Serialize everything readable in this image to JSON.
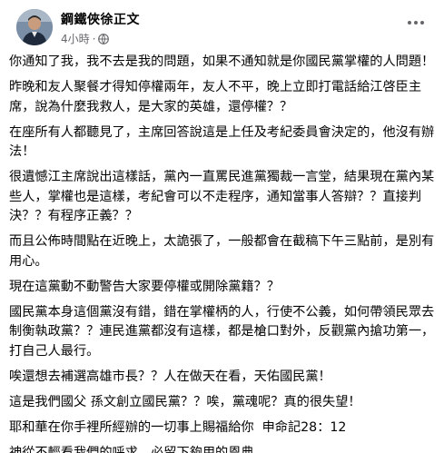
{
  "post": {
    "author": "鋼鐵俠徐正文",
    "time": "4小時",
    "separator": "·",
    "paragraphs": [
      "你通知了我，我不去是我的問題，如果不通知就是你國民黨掌權的人問題！",
      "昨晚和友人聚餐才得知停權兩年，友人不平，晚上立即打電話給江啓臣主席，說為什麼我救人，是大家的英雄，還停權？？",
      "在座所有人都聽見了，主席回答說這是上任及考紀委員會決定的，他沒有辦法！",
      "很遺憾江主席說出這樣話，黨內一直罵民進黨獨裁一言堂，結果現在黨內某些人，掌權也是這樣，考紀會可以不走程序，通知當事人答辯？？直接判決？？有程序正義？？",
      "而且公佈時間點在近晚上，太詭張了，一般都會在截稿下午三點前，是別有用心。",
      "現在這黨動不動警告大家要停權或開除黨籍？？",
      "國民黨本身這個黨沒有錯，錯在掌權柄的人，行使不公義，如何帶領民眾去制衡執政黨？？連民進黨都沒有這樣，都是槍口對外，反觀黨內搶功第一，打自己人最行。",
      "唉還想去補選高雄市長？？人在做天在看，天佑國民黨！",
      "這是我們國父 孫文創立國民黨？？唉，黨魂呢？真的很失望！",
      "耶和華在你手裡所經辦的一切事上賜福給你  申命記28：12",
      "神從不輕看我們的呼求，必留下夠用的恩典。"
    ]
  },
  "icons": {
    "globe": "globe-icon",
    "more": "more-options-icon"
  }
}
